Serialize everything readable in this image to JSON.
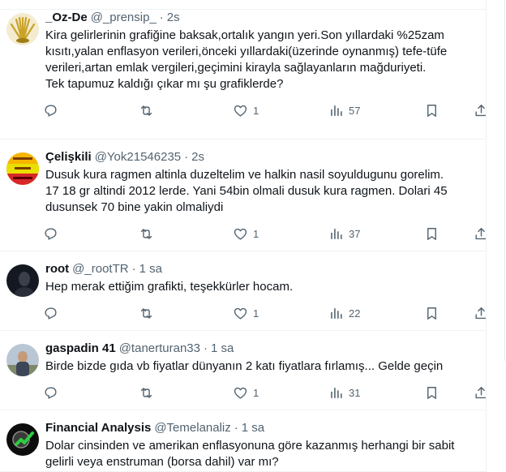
{
  "tweets": [
    {
      "name": "_Oz-De",
      "handle": "@_prensip_",
      "time": "2s",
      "text": "Kira gelirlerinin grafiğine baksak,ortalık yangın yeri.Son yıllardaki %25zam\nkısıtı,yalan enflasyon verileri,önceki yıllardaki(üzerinde oynanmış) tefe-tüfe\nverileri,artan emlak vergileri,geçimini kirayla sağlayanların mağduriyeti.\nTek tapumuz kaldığı çıkar mı şu grafiklerde?",
      "likes": "1",
      "views": "57",
      "avatar_color": "#c9a227"
    },
    {
      "name": "Çelişkili",
      "handle": "@Yok21546235",
      "time": "2s",
      "text": "Dusuk kura ragmen altinla duzeltelim ve halkin nasil soyuldugunu gorelim.\n17 18 gr altindi 2012 lerde. Yani 54bin olmali dusuk kura ragmen. Dolari 45\ndusunsek 70 bine yakin olmaliydi",
      "likes": "1",
      "views": "37",
      "avatar_color": "#f2a900"
    },
    {
      "name": "root",
      "handle": "@_rootTR",
      "time": "1 sa",
      "text": "Hep merak ettiğim grafikti, teşekkürler hocam.",
      "likes": "1",
      "views": "22",
      "avatar_color": "#1a1f2b"
    },
    {
      "name": "gaspadin 41",
      "handle": "@tanerturan33",
      "time": "1 sa",
      "text": "Birde bizde gıda vb fiyatlar dünyanın 2 katı fiyatlara fırlamış... Gelde geçin",
      "likes": "1",
      "views": "31",
      "avatar_color": "#8a9bb0"
    },
    {
      "name": "Financial Analysis",
      "handle": "@Temelanaliz",
      "time": "1 sa",
      "text": "Dolar cinsinden ve amerikan enflasyonuna göre kazanmış herhangi bir sabit\ngelirli veya enstruman (borsa dahil) var mı?",
      "avatar_color": "#111111"
    }
  ],
  "separator": "·"
}
